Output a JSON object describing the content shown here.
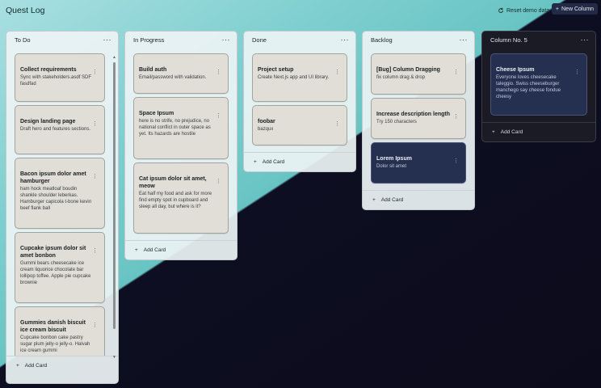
{
  "app": {
    "title": "Quest Log"
  },
  "header": {
    "reset_label": "Reset demo data",
    "new_column_label": "New Column"
  },
  "columns": [
    {
      "title": "To Do",
      "menu": "···",
      "add_label": "Add Card",
      "cards": [
        {
          "title": "Collect requirements",
          "desc": "Sync with stakeholders.asdf SDF fasdfad"
        },
        {
          "title": "Design landing page",
          "desc": "Draft hero and features sections."
        },
        {
          "title": "Bacon ipsum dolor amet hamburger",
          "desc": "ham hock meatloaf boudin shankle shoulder leberkas. Hamburger capicola t-bone kevin beef flank ball"
        },
        {
          "title": "Cupcake ipsum dolor sit amet bonbon",
          "desc": "Gummi bears cheesecake ice cream liquorice chocolate bar lollipop toffee. Apple pie cupcake brownie"
        },
        {
          "title": "Gummies danish biscuit ice cream biscuit",
          "desc": "Cupcake bonbon cake pastry sugar plum jelly-o jelly-o. Halvah ice cream gummi"
        }
      ]
    },
    {
      "title": "In Progress",
      "menu": "···",
      "add_label": "Add Card",
      "cards": [
        {
          "title": "Build auth",
          "desc": "Email/password with validation."
        },
        {
          "title": "Space Ipsum",
          "desc": "here is no strife, no prejudice, no national conflict in outer space as yet. Its hazards are hostile"
        },
        {
          "title": "Cat ipsum dolor sit amet, meow",
          "desc": "Eat half my food and ask for more find empty spot in cupboard and sleep all day, but where is it?"
        }
      ]
    },
    {
      "title": "Done",
      "menu": "···",
      "add_label": "Add Card",
      "cards": [
        {
          "title": "Project setup",
          "desc": "Create Next.js app and UI library."
        },
        {
          "title": "foobar",
          "desc": "bazqux"
        }
      ]
    },
    {
      "title": "Backlog",
      "menu": "···",
      "add_label": "Add Card",
      "cards": [
        {
          "title": "[Bug] Column Dragging",
          "desc": "fix column drag & drop"
        },
        {
          "title": "Increase description length",
          "desc": "Try 150 characters"
        },
        {
          "title": "Lorem Ipsum",
          "desc": "Dolor sit amet"
        }
      ]
    },
    {
      "title": "Column No. 5",
      "menu": "···",
      "add_label": "Add Card",
      "cards": [
        {
          "title": "Cheese Ipsum",
          "desc": "Everyone loves cheesecake taleggio. Swiss cheeseburger manchego say cheese fondue cheesy"
        }
      ]
    }
  ],
  "icons": {
    "reset": "refresh-icon",
    "add": "plus-icon",
    "card_menu": "vertical-ellipsis-icon",
    "column_menu": "horizontal-ellipsis-icon"
  }
}
